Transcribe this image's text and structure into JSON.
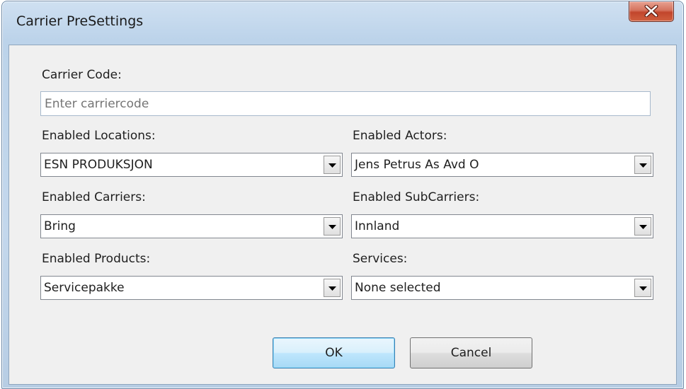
{
  "window": {
    "title": "Carrier PreSettings"
  },
  "carrier_code": {
    "label": "Carrier Code:",
    "placeholder": "Enter carriercode",
    "value": ""
  },
  "fields": {
    "locations": {
      "label": "Enabled Locations:",
      "value": "ESN PRODUKSJON"
    },
    "actors": {
      "label": "Enabled Actors:",
      "value": "Jens Petrus As Avd O"
    },
    "carriers": {
      "label": "Enabled Carriers:",
      "value": "Bring"
    },
    "subcarriers": {
      "label": "Enabled SubCarriers:",
      "value": "Innland"
    },
    "products": {
      "label": "Enabled Products:",
      "value": "Servicepakke"
    },
    "services": {
      "label": "Services:",
      "value": "None selected"
    }
  },
  "buttons": {
    "ok": "OK",
    "cancel": "Cancel"
  },
  "icons": {
    "close": "close-icon",
    "dropdown": "chevron-down-icon"
  }
}
